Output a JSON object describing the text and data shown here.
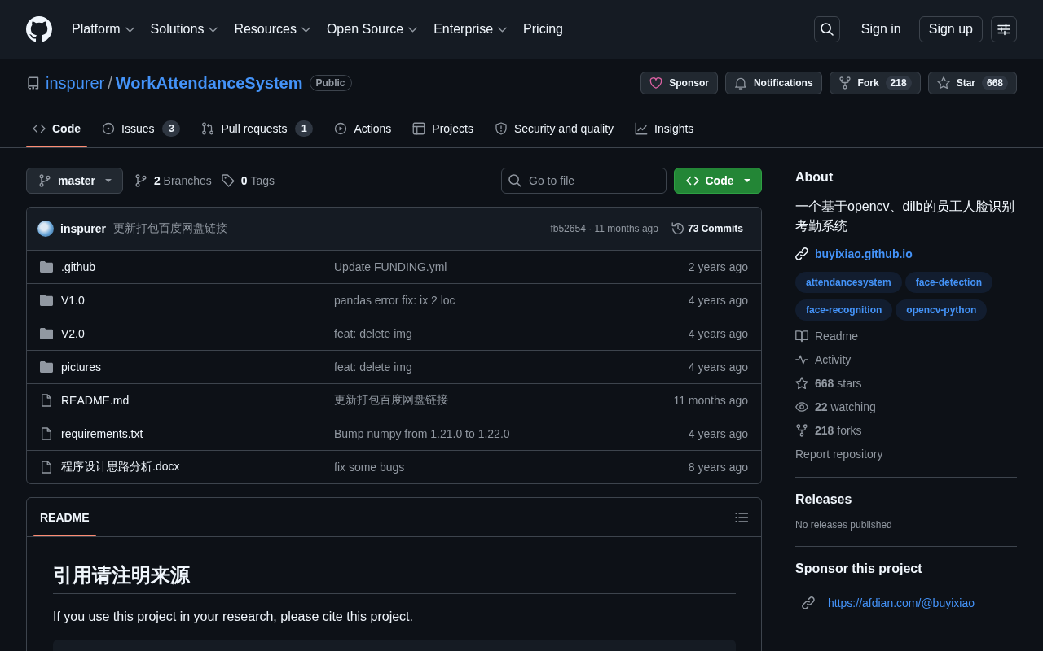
{
  "header": {
    "nav": [
      {
        "label": "Platform",
        "dropdown": true
      },
      {
        "label": "Solutions",
        "dropdown": true
      },
      {
        "label": "Resources",
        "dropdown": true
      },
      {
        "label": "Open Source",
        "dropdown": true
      },
      {
        "label": "Enterprise",
        "dropdown": true
      },
      {
        "label": "Pricing",
        "dropdown": false
      }
    ],
    "sign_in": "Sign in",
    "sign_up": "Sign up"
  },
  "repo": {
    "owner": "inspurer",
    "separator": "/",
    "name": "WorkAttendanceSystem",
    "visibility": "Public",
    "actions": [
      {
        "kind": "sponsor",
        "label": "Sponsor"
      },
      {
        "kind": "notifications",
        "label": "Notifications"
      },
      {
        "kind": "fork",
        "label": "Fork",
        "count": "218"
      },
      {
        "kind": "star",
        "label": "Star",
        "count": "668"
      }
    ]
  },
  "tabs": [
    {
      "kind": "code",
      "label": "Code",
      "selected": true
    },
    {
      "kind": "issues",
      "label": "Issues",
      "count": "3",
      "selected": false
    },
    {
      "kind": "pull_requests",
      "label": "Pull requests",
      "count": "1",
      "selected": false
    },
    {
      "kind": "actions",
      "label": "Actions",
      "selected": false
    },
    {
      "kind": "projects",
      "label": "Projects",
      "selected": false
    },
    {
      "kind": "security",
      "label": "Security and quality",
      "selected": false
    },
    {
      "kind": "insights",
      "label": "Insights",
      "selected": false
    }
  ],
  "toolbar": {
    "branch": "master",
    "branches": {
      "count": "2",
      "label": "Branches"
    },
    "tags": {
      "count": "0",
      "label": "Tags"
    },
    "search": {
      "placeholder": "Go to file"
    },
    "code_button": "Code"
  },
  "latest_commit": {
    "author": "inspurer",
    "message": "更新打包百度网盘链接",
    "meta": "fb52654 · 11 months ago",
    "commits": "73 Commits"
  },
  "files": [
    {
      "kind": "folder",
      "name": ".github",
      "message": "Update FUNDING.yml",
      "time": "2 years ago"
    },
    {
      "kind": "folder",
      "name": "V1.0",
      "message": "pandas error fix: ix 2 loc",
      "time": "4 years ago"
    },
    {
      "kind": "folder",
      "name": "V2.0",
      "message": "feat: delete img",
      "time": "4 years ago"
    },
    {
      "kind": "folder",
      "name": "pictures",
      "message": "feat: delete img",
      "time": "4 years ago"
    },
    {
      "kind": "file",
      "name": "README.md",
      "message": "更新打包百度网盘链接",
      "time": "11 months ago"
    },
    {
      "kind": "file",
      "name": "requirements.txt",
      "message": "Bump numpy from 1.21.0 to 1.22.0",
      "time": "4 years ago"
    },
    {
      "kind": "file",
      "name": "程序设计思路分析.docx",
      "message": "fix some bugs",
      "time": "8 years ago"
    }
  ],
  "readme": {
    "tab": {
      "label": "README",
      "selected": true
    },
    "heading": "引用请注明来源",
    "paragraph": "If you use this project in your research, please cite this project."
  },
  "about": {
    "title": "About",
    "description": "一个基于opencv、dilb的员工人脸识别考勤系统",
    "website": "buyixiao.github.io",
    "topics": [
      "attendancesystem",
      "face-detection",
      "face-recognition",
      "opencv-python"
    ],
    "stats": [
      {
        "kind": "readme",
        "label": "Readme"
      },
      {
        "kind": "activity",
        "label": "Activity"
      },
      {
        "kind": "stars",
        "count": "668",
        "label": "stars"
      },
      {
        "kind": "watching",
        "count": "22",
        "label": "watching"
      },
      {
        "kind": "forks",
        "count": "218",
        "label": "forks"
      }
    ],
    "report": "Report repository"
  },
  "releases": {
    "title": "Releases",
    "empty": "No releases published"
  },
  "sponsor": {
    "title": "Sponsor this project",
    "links": [
      "https://afdian.com/@buyixiao"
    ]
  }
}
